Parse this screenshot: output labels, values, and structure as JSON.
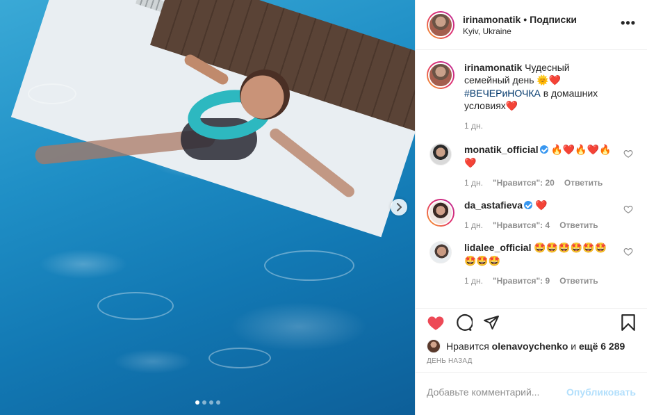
{
  "post": {
    "carousel": {
      "total_slides": 4,
      "active_slide": 1
    }
  },
  "header": {
    "username": "irinamonatik",
    "separator": "•",
    "follow_label": "Подписки",
    "location": "Kyiv, Ukraine",
    "more_label": "•••"
  },
  "caption": {
    "username": "irinamonatik",
    "text_before": "Чудесный семейный день ",
    "emojis": "🌞❤️",
    "hashtag": "#ВЕЧЕРиНОЧКА",
    "text_after": " в домашних условиях",
    "trailing_emoji": "❤️",
    "time": "1 дн."
  },
  "comments": [
    {
      "username": "monatik_official",
      "verified": true,
      "text": "🔥❤️🔥❤️🔥❤️",
      "time": "1 дн.",
      "likes": "\"Нравится\": 20",
      "reply": "Ответить"
    },
    {
      "username": "da_astafieva",
      "verified": true,
      "text": "❤️",
      "time": "1 дн.",
      "likes": "\"Нравится\": 4",
      "reply": "Ответить"
    },
    {
      "username": "lidalee_official",
      "verified": false,
      "text": "🤩🤩🤩🤩🤩🤩🤩🤩🤩",
      "time": "1 дн.",
      "likes": "\"Нравится\": 9",
      "reply": "Ответить"
    }
  ],
  "likes": {
    "prefix": "Нравится",
    "liker": "olenavoychenko",
    "middle": "и",
    "others": "ещё 6 289"
  },
  "date": "ДЕНЬ НАЗАД",
  "add_comment": {
    "placeholder": "Добавьте комментарий...",
    "publish_label": "Опубликовать"
  },
  "colors": {
    "like_active": "#ed4956",
    "verified": "#3897f0",
    "hashtag": "#00376b",
    "publish_disabled": "#b2dffc",
    "muted": "#8e8e8e"
  },
  "icons": [
    "chevron-right-icon",
    "more-icon",
    "heart-filled-icon",
    "comment-icon",
    "share-icon",
    "bookmark-icon",
    "heart-outline-icon",
    "verified-icon"
  ]
}
